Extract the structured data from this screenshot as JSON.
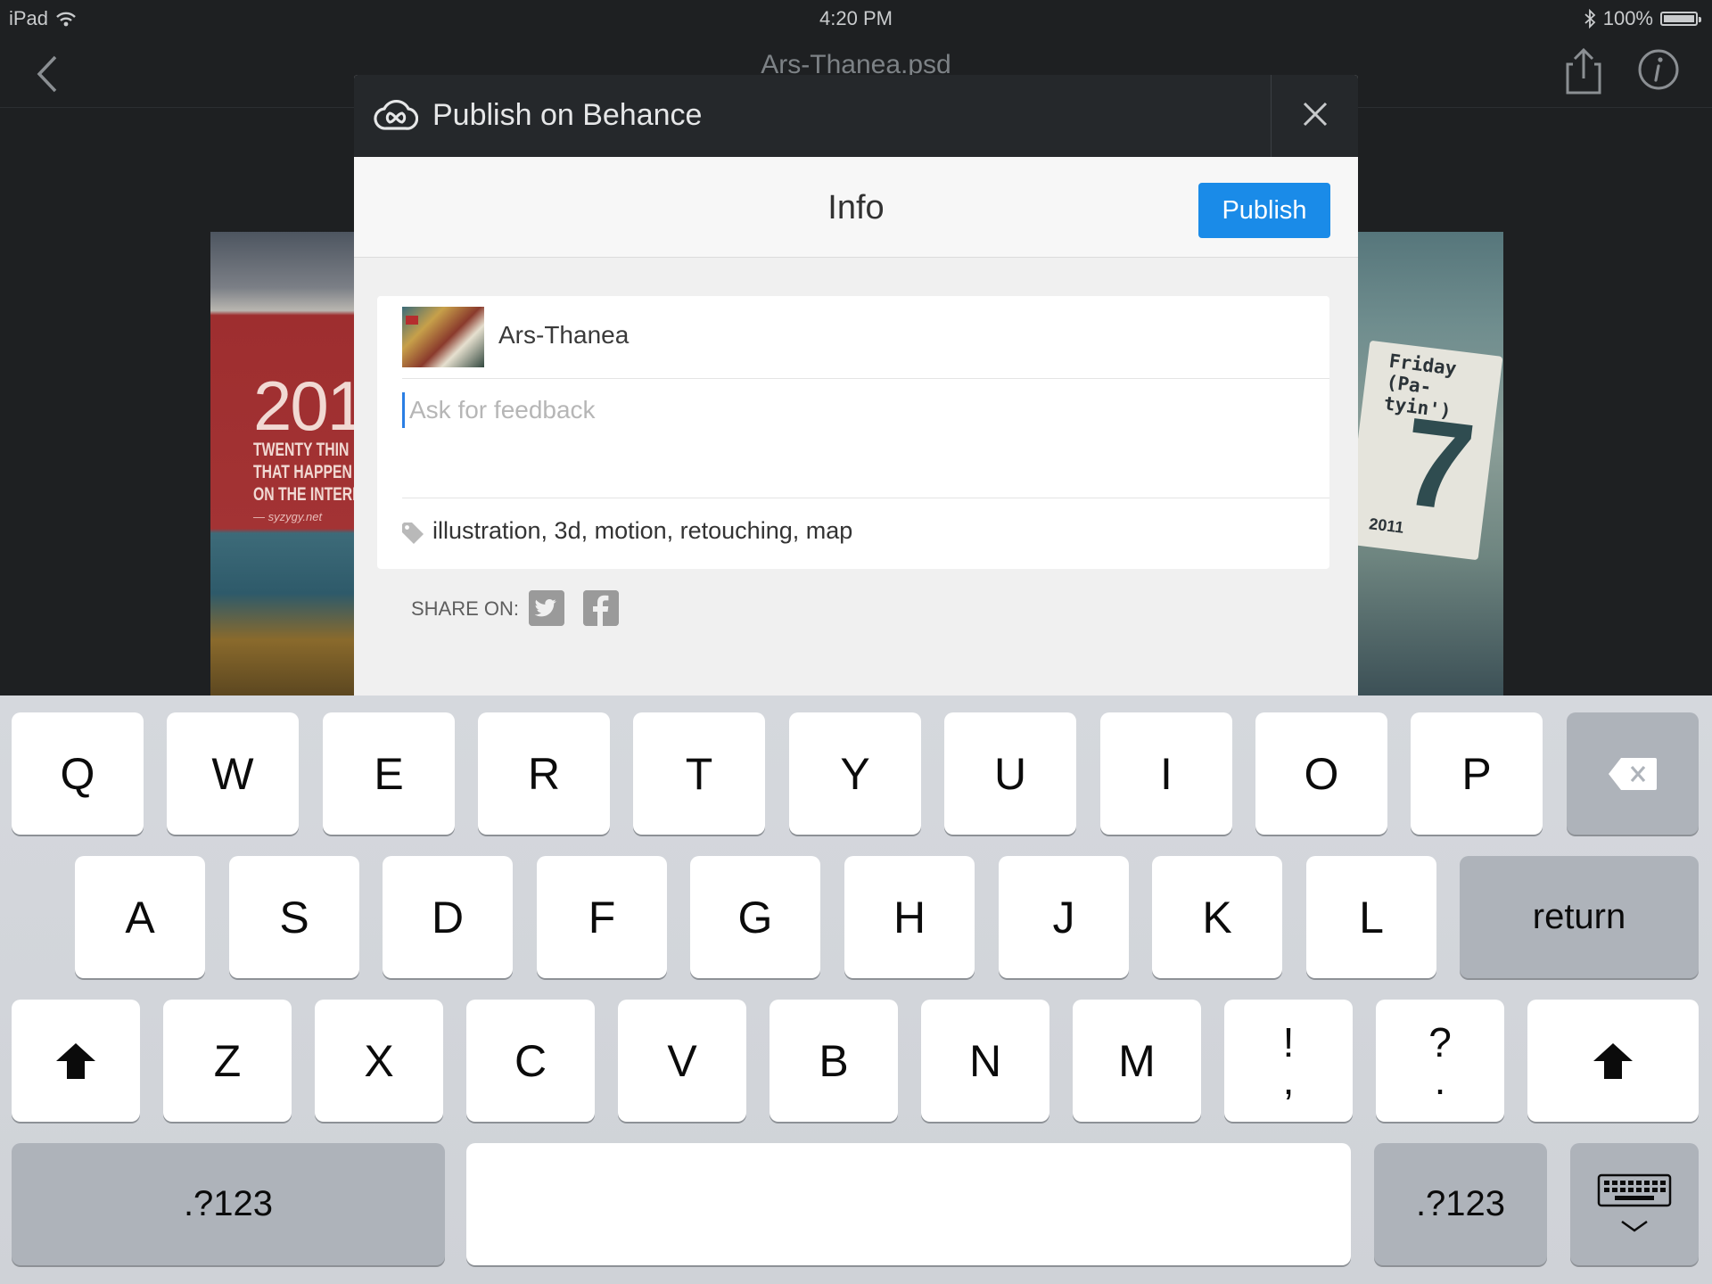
{
  "status_bar": {
    "device": "iPad",
    "time": "4:20 PM",
    "battery": "100%"
  },
  "nav": {
    "document_title": "Ars-Thanea.psd"
  },
  "background": {
    "left_thumb": {
      "big_text": "201",
      "lines": [
        "TWENTY THIN",
        "THAT HAPPEN",
        "ON THE INTERN"
      ],
      "url": "— syzygy.net"
    },
    "right_thumb": {
      "friday": "Friday",
      "partyin": "(Pa-tyin')",
      "day": "7",
      "year": "2011"
    }
  },
  "modal": {
    "title": "Publish on Behance",
    "section_title": "Info",
    "publish_label": "Publish",
    "project_name": "Ars-Thanea",
    "feedback_placeholder": "Ask for feedback",
    "feedback_value": "",
    "tags": "illustration, 3d, motion, retouching, map",
    "share_label": "SHARE ON:",
    "share_targets": [
      "twitter-icon",
      "facebook-icon"
    ]
  },
  "keyboard": {
    "row1": [
      "Q",
      "W",
      "E",
      "R",
      "T",
      "Y",
      "U",
      "I",
      "O",
      "P"
    ],
    "row2": [
      "A",
      "S",
      "D",
      "F",
      "G",
      "H",
      "J",
      "K",
      "L"
    ],
    "row3": [
      "Z",
      "X",
      "C",
      "V",
      "B",
      "N",
      "M"
    ],
    "punct1": {
      "top": "!",
      "bottom": ","
    },
    "punct2": {
      "top": "?",
      "bottom": "."
    },
    "return_label": "return",
    "numbers_label": ".?123"
  },
  "colors": {
    "accent": "#1a8be8",
    "header": "#25282b",
    "background": "#1e2022",
    "keyboard": "#d2d5da"
  }
}
